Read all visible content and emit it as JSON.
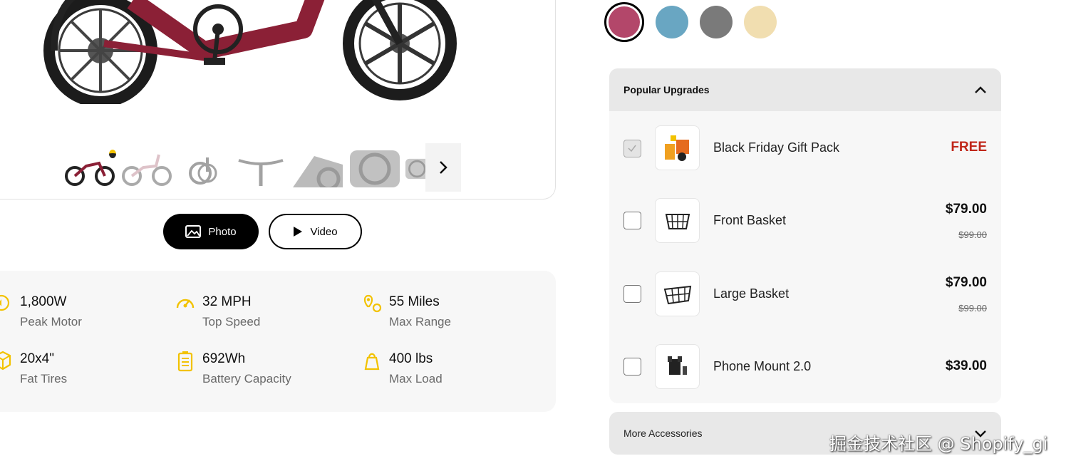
{
  "media": {
    "photo_label": "Photo",
    "video_label": "Video"
  },
  "specs": [
    {
      "icon": "motor-icon",
      "value": "1,800W",
      "label": "Peak Motor"
    },
    {
      "icon": "speedometer-icon",
      "value": "32 MPH",
      "label": "Top Speed"
    },
    {
      "icon": "location-range-icon",
      "value": "55 Miles",
      "label": "Max Range"
    },
    {
      "icon": "tire-cube-icon",
      "value": "20x4\"",
      "label": "Fat Tires"
    },
    {
      "icon": "battery-icon",
      "value": "692Wh",
      "label": "Battery Capacity"
    },
    {
      "icon": "weight-icon",
      "value": "400 lbs",
      "label": "Max Load"
    }
  ],
  "colors": {
    "accent_icon": "#f2c200",
    "swatches": [
      "#b3476a",
      "#69a6c2",
      "#7a7a7a",
      "#f1deb0"
    ]
  },
  "upgrades": {
    "title": "Popular Upgrades",
    "items": [
      {
        "name": "Black Friday Gift Pack",
        "price": "FREE",
        "old_price": "",
        "checked": true,
        "icon": "gift-pack-icon"
      },
      {
        "name": "Front Basket",
        "price": "$79.00",
        "old_price": "$99.00",
        "checked": false,
        "icon": "front-basket-icon"
      },
      {
        "name": "Large Basket",
        "price": "$79.00",
        "old_price": "$99.00",
        "checked": false,
        "icon": "large-basket-icon"
      },
      {
        "name": "Phone Mount 2.0",
        "price": "$39.00",
        "old_price": "",
        "checked": false,
        "icon": "phone-mount-icon"
      }
    ]
  },
  "more_accessories": {
    "title": "More Accessories"
  },
  "watermark": "掘金技术社区 @ Shopify_gi"
}
